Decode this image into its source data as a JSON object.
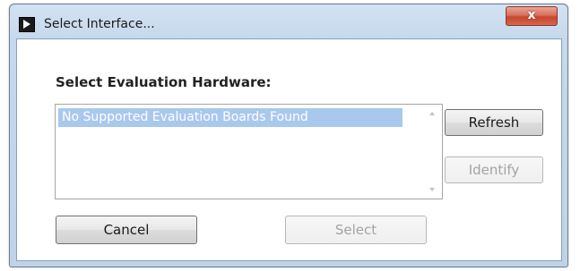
{
  "window": {
    "title": "Select Interface...",
    "close_label": "x"
  },
  "main": {
    "heading": "Select Evaluation Hardware:",
    "list": {
      "items": [
        {
          "label": "No Supported Evaluation Boards Found",
          "selected": true
        }
      ]
    }
  },
  "buttons": {
    "refresh": "Refresh",
    "identify": "Identify",
    "cancel": "Cancel",
    "select": "Select"
  },
  "colors": {
    "selection": "#a9c8ee",
    "close_button": "#c8452f",
    "frame": "#c6d8ec"
  }
}
